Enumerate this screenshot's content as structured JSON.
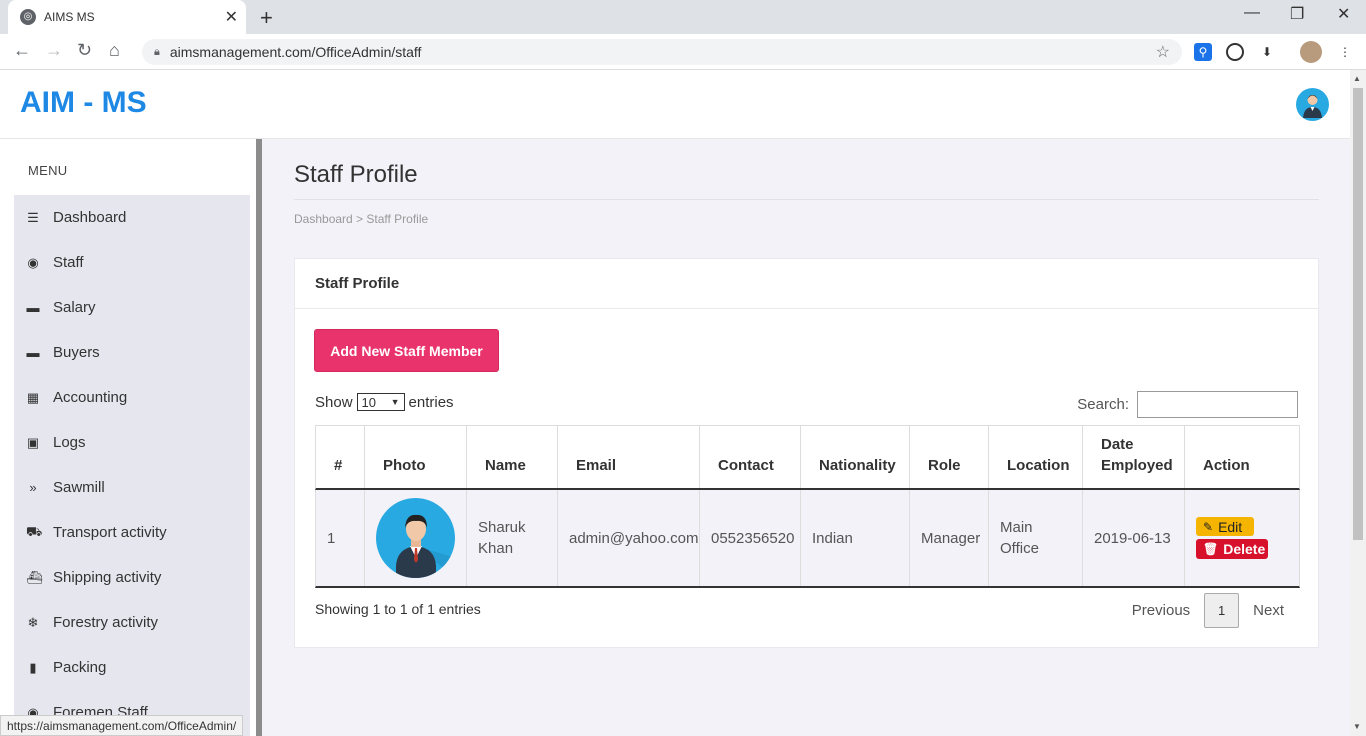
{
  "browser": {
    "tab_title": "AIMS MS",
    "url": "aimsmanagement.com/OfficeAdmin/staff",
    "status_url": "https://aimsmanagement.com/OfficeAdmin/"
  },
  "app": {
    "logo": "AIM - MS"
  },
  "sidebar": {
    "heading": "MENU",
    "items": [
      {
        "label": "Dashboard",
        "icon": "☰"
      },
      {
        "label": "Staff",
        "icon": "◉"
      },
      {
        "label": "Salary",
        "icon": "▬"
      },
      {
        "label": "Buyers",
        "icon": "▬"
      },
      {
        "label": "Accounting",
        "icon": "▦"
      },
      {
        "label": "Logs",
        "icon": "▣"
      },
      {
        "label": "Sawmill",
        "icon": "»"
      },
      {
        "label": "Transport activity",
        "icon": "⛟"
      },
      {
        "label": "Shipping activity",
        "icon": "⛴"
      },
      {
        "label": "Forestry activity",
        "icon": "❄"
      },
      {
        "label": "Packing",
        "icon": "▮"
      },
      {
        "label": "Foremen Staff",
        "icon": "◉"
      }
    ]
  },
  "page": {
    "title": "Staff Profile",
    "breadcrumb": "Dashboard > Staff Profile",
    "card_title": "Staff Profile",
    "add_button": "Add New Staff Member",
    "show_label": "Show",
    "entries_value": "10",
    "entries_label": "entries",
    "search_label": "Search:",
    "search_value": "",
    "info": "Showing 1 to 1 of 1 entries",
    "pager": {
      "previous": "Previous",
      "current": "1",
      "next": "Next"
    }
  },
  "table": {
    "headers": [
      "#",
      "Photo",
      "Name",
      "Email",
      "Contact",
      "Nationality",
      "Role",
      "Location",
      "Date Employed",
      "Action"
    ],
    "rows": [
      {
        "num": "1",
        "name": "Sharuk Khan",
        "email": "admin@yahoo.com",
        "contact": "0552356520",
        "nationality": "Indian",
        "role": "Manager",
        "location": "Main Office",
        "date_employed": "2019-06-13",
        "edit_label": "Edit",
        "delete_label": "Delete"
      }
    ]
  },
  "colors": {
    "brand": "#1e88e5",
    "add_button": "#e9336c",
    "edit": "#f5b400",
    "delete": "#d7102b",
    "avatar": "#29a9e1"
  }
}
